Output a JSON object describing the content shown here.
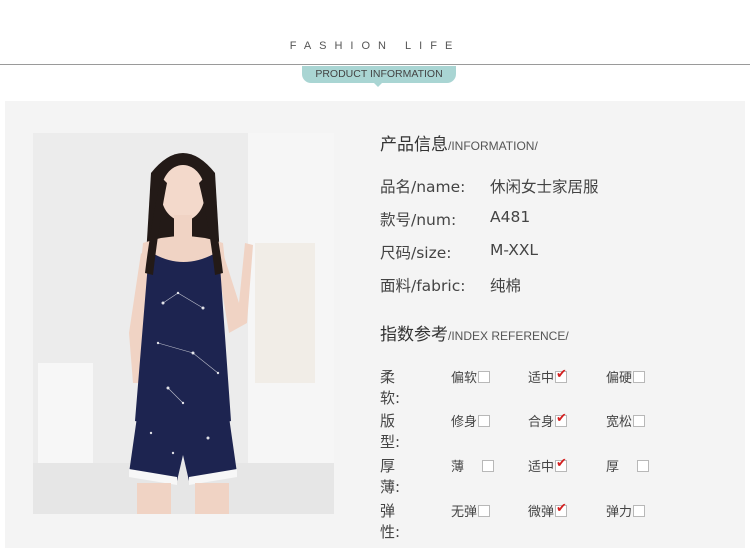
{
  "header": {
    "title": "FASHION LIFE",
    "ribbon": "PRODUCT INFORMATION"
  },
  "colors": {
    "ribbon": "#a9d5d3",
    "panel": "#f4f4f4",
    "check": "#d42020",
    "garment": "#1d2450"
  },
  "product_info": {
    "title_cn": "产品信息",
    "title_en": "/INFORMATION/",
    "rows": [
      {
        "label": "品名/name:",
        "value": "休闲女士家居服"
      },
      {
        "label": "款号/num:",
        "value": "A481"
      },
      {
        "label": "尺码/size:",
        "value": "M-XXL"
      },
      {
        "label": "面料/fabric:",
        "value": "纯棉"
      }
    ]
  },
  "index_reference": {
    "title_cn": "指数参考",
    "title_en": "/INDEX REFERENCE/",
    "rows": [
      {
        "label": "柔软:",
        "options": [
          {
            "text": "偏软",
            "checked": false
          },
          {
            "text": "适中",
            "checked": true
          },
          {
            "text": "偏硬",
            "checked": false
          }
        ]
      },
      {
        "label": "版型:",
        "options": [
          {
            "text": "修身",
            "checked": false
          },
          {
            "text": "合身",
            "checked": true
          },
          {
            "text": "宽松",
            "checked": false
          }
        ]
      },
      {
        "label": "厚薄:",
        "options": [
          {
            "text": "薄",
            "checked": false
          },
          {
            "text": "适中",
            "checked": true
          },
          {
            "text": "厚",
            "checked": false
          }
        ]
      },
      {
        "label": "弹性:",
        "options": [
          {
            "text": "无弹",
            "checked": false
          },
          {
            "text": "微弹",
            "checked": true
          },
          {
            "text": "弹力",
            "checked": false
          }
        ]
      }
    ]
  },
  "check_mark": "✔"
}
